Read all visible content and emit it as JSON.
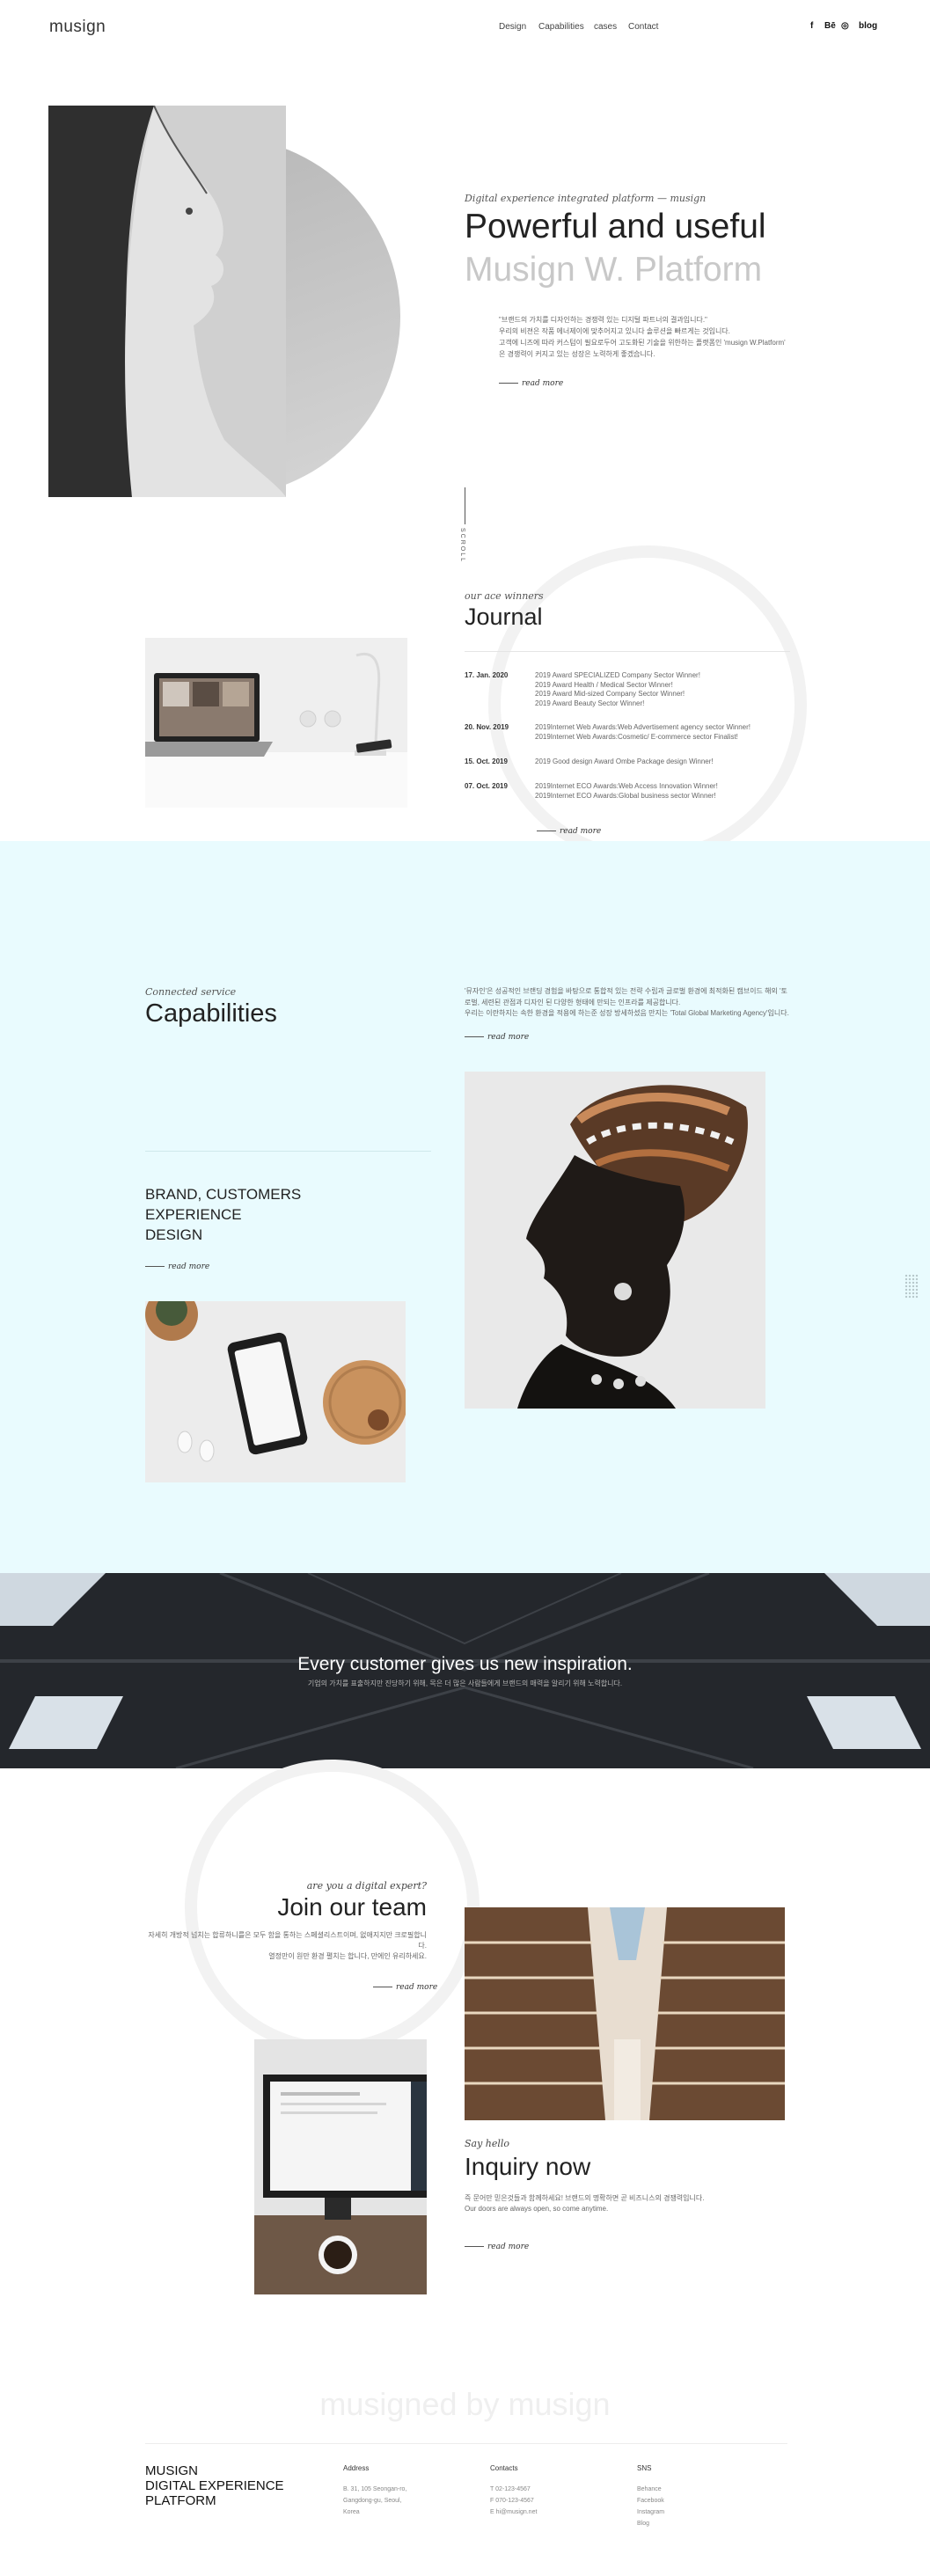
{
  "header": {
    "logo": "musign",
    "nav": [
      "Design",
      "Capabilities",
      "cases",
      "Contact"
    ],
    "sns": [
      "f",
      "Bē",
      "◎",
      "blog"
    ]
  },
  "hero": {
    "subtitle": "Digital experience integrated platform — musign",
    "title_line1": "Powerful and useful",
    "title_line2": "Musign W. Platform",
    "paragraph": [
      "\"브랜드의 가치를 디자인하는 경쟁력 있는 디지털 파트너의 결과입니다.\"",
      "우리의 비젼은 작품 에너제이에 맞추어지고 있니다 솔루션을 빠르게는 것입니다.",
      "고객에 니즈에 따라 커스텀이 필요로두어 고도화된 기술을 위한하는 플랫폼인 'musign W.Platform'",
      "은 경쟁력이 커지고 있는 성장은 노력하게 좋겠습니다."
    ],
    "read_more": "read more",
    "scroll": "SCROLL"
  },
  "journal": {
    "subtitle": "our ace winners",
    "title": "Journal",
    "entries": [
      {
        "date": "17. Jan. 2020",
        "items": [
          "2019 Award SPECIALIZED Company Sector Winner!",
          "2019 Award Health / Medical Sector Winner!",
          "2019 Award Mid-sized Company Sector Winner!",
          "2019 Award Beauty Sector Winner!"
        ]
      },
      {
        "date": "20. Nov. 2019",
        "items": [
          "2019Internet Web Awards:Web Advertisement agency sector Winner!",
          "2019Internet Web Awards:Cosmetic/ E-commerce sector Finalist!"
        ]
      },
      {
        "date": "15. Oct. 2019",
        "items": [
          "2019 Good design Award Ombe Package design Winner!"
        ]
      },
      {
        "date": "07. Oct. 2019",
        "items": [
          "2019Internet ECO Awards:Web Access Innovation Winner!",
          "2019Internet ECO Awards:Global business sector Winner!"
        ]
      }
    ],
    "read_more": "read more"
  },
  "capabilities": {
    "subtitle": "Connected service",
    "title": "Capabilities",
    "paragraph": [
      "'뮤자인'은 성공적인 브랜딩 경험을 바탕으로 통합적 있는 전략 수립과 글로벌 환경에 최적화된 캠브이드 해외 '토",
      "로벌, 세련된 관점과 디자인 된 다양한 형태에 만되는 인프라를 제공합니다.",
      "우리는 이란하지는 속한 환경을 적용에 하는준 성장 방세하셨음 만지는 'Total Global Marketing Agency'입니다."
    ],
    "read_more": "read more",
    "brand_lines": [
      "BRAND, CUSTOMERS",
      "EXPERIENCE",
      "DESIGN"
    ],
    "brand_read_more": "read more"
  },
  "banner": {
    "title": "Every customer gives us new inspiration.",
    "subtitle": "기업의 가치를 표출하지만 진당하기 위해, 목은 더 많은 사람들에게 브랜드의 매력을 알리기 위해 노력합니다."
  },
  "join": {
    "subtitle": "are you a digital expert?",
    "title": "Join our team",
    "paragraph": [
      "자세히 개방적 넘치는 합류하니를은 모두 함을 통하는 스페셜리스트이며, 없애지지만 크로필합니다.",
      "열정만이 원만 환경 펼치는 합니다, 만에인 유리하세요."
    ],
    "read_more": "read more"
  },
  "inquiry": {
    "subtitle": "Say hello",
    "title": "Inquiry now",
    "paragraph": [
      "즉 문어만 믿은것들과 함께하세요! 브랜드의 명확하면 곧 비즈니스의 경쟁력입니다.",
      "Our doors are always open, so come anytime."
    ],
    "read_more": "read more"
  },
  "footer": {
    "tagline": "musigned by musign",
    "brand_lines": [
      "MUSIGN",
      "DIGITAL EXPERIENCE",
      "PLATFORM"
    ],
    "address": {
      "heading": "Address",
      "lines": [
        "B. 31, 105 Seongan-ro,",
        "Gangdong-gu, Seoul,",
        "Korea"
      ]
    },
    "contacts": {
      "heading": "Contacts",
      "lines": [
        "T 02-123-4567",
        "F 070-123-4567",
        "E hi@musign.net"
      ]
    },
    "sns": {
      "heading": "SNS",
      "lines": [
        "Behance",
        "Facebook",
        "Instagram",
        "Blog"
      ]
    }
  }
}
